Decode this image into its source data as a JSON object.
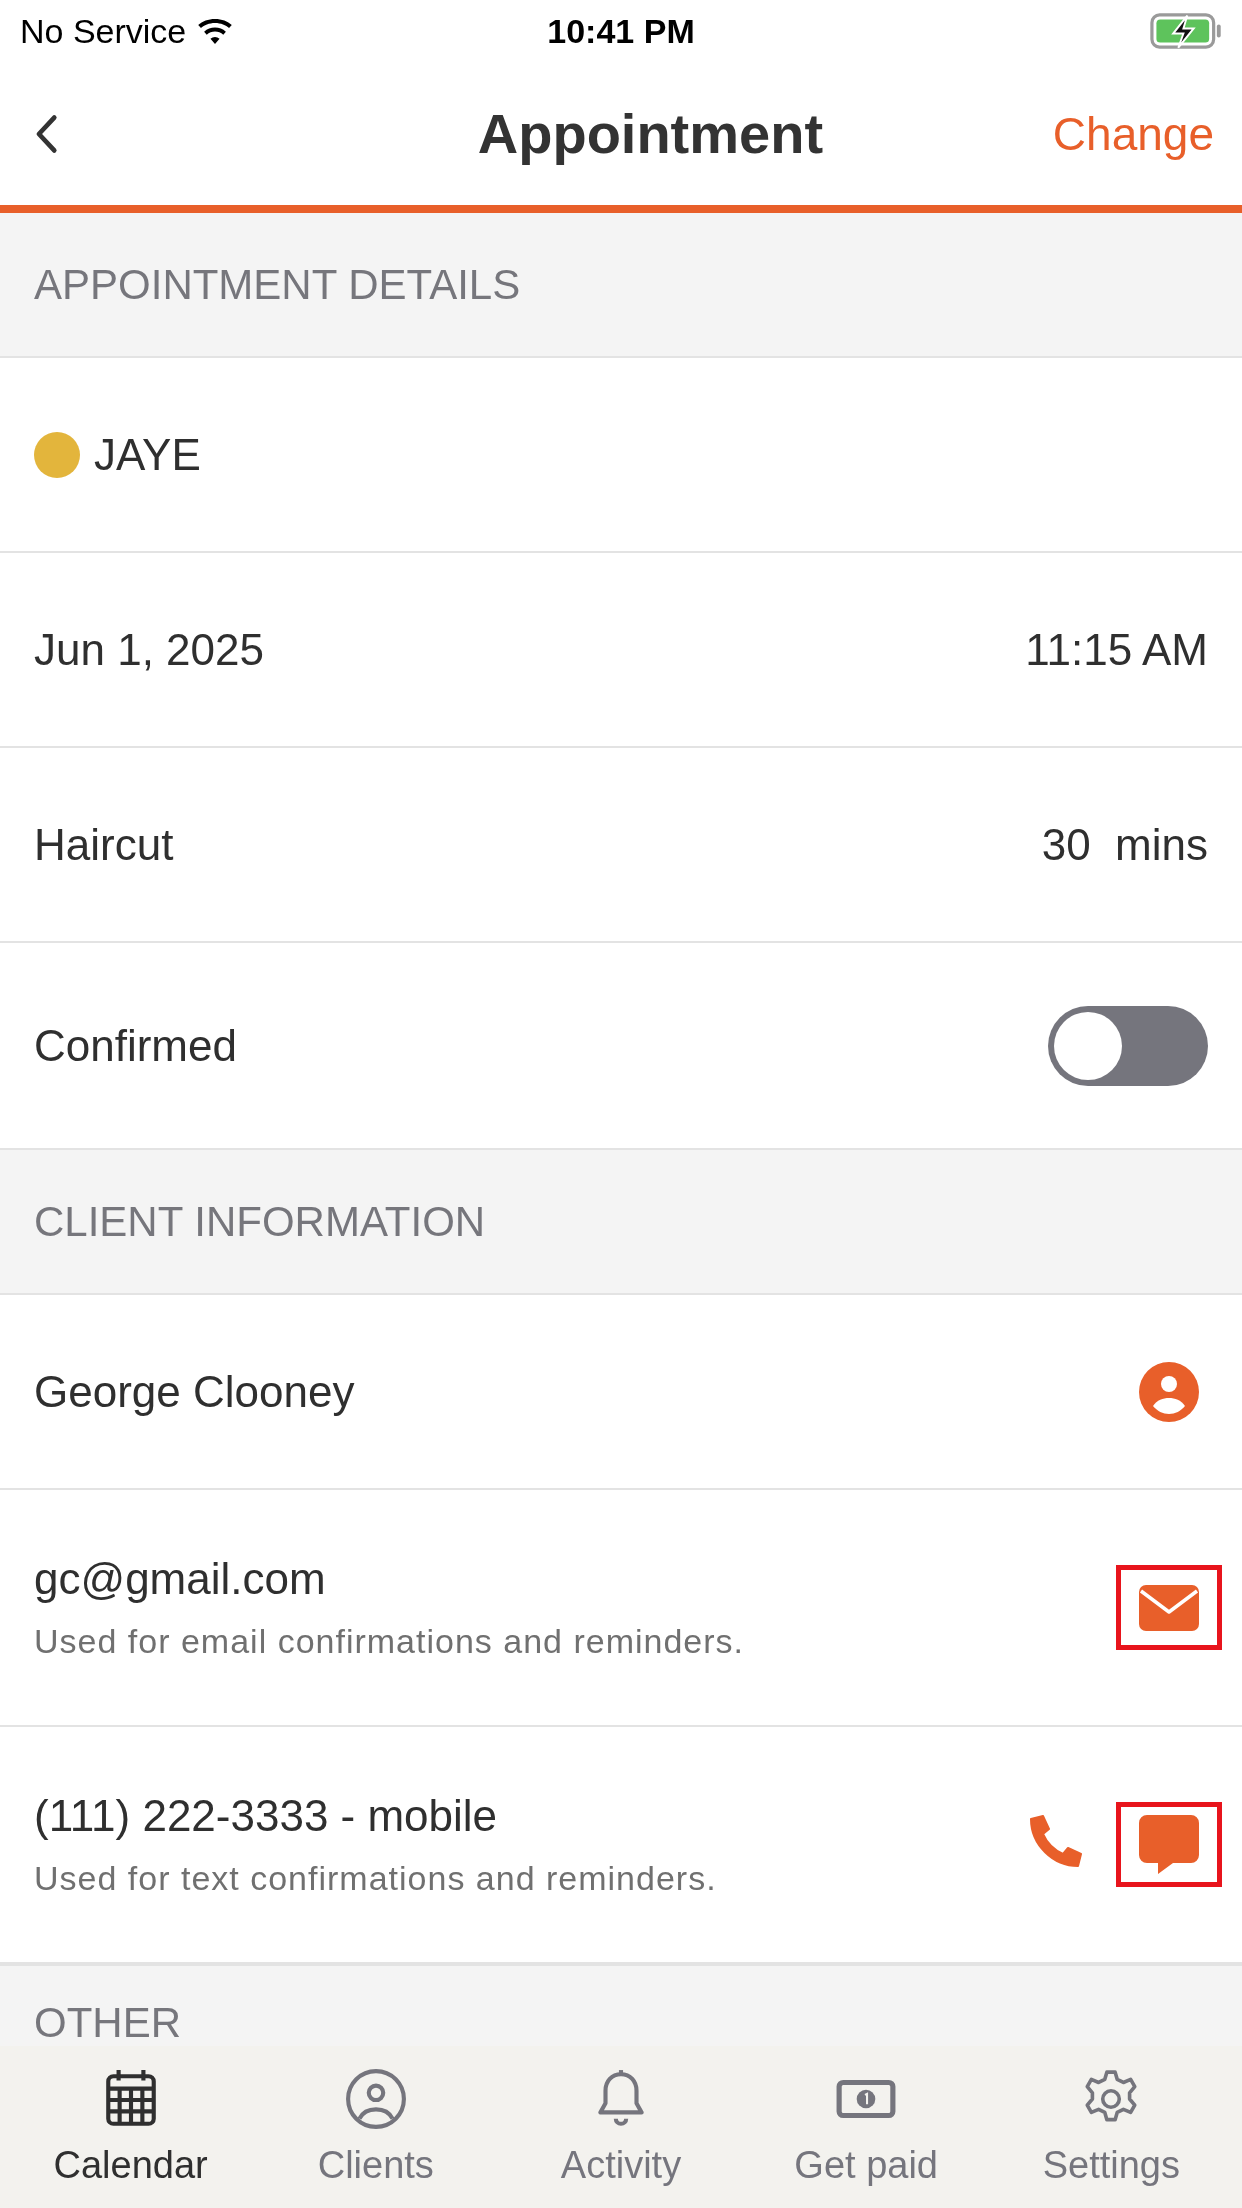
{
  "status_bar": {
    "carrier": "No Service",
    "time": "10:41 PM"
  },
  "nav": {
    "title": "Appointment",
    "action": "Change"
  },
  "sections": [
    {
      "header": "APPOINTMENT DETAILS",
      "rows": [
        {
          "kind": "staff",
          "label": "JAYE",
          "color": "#e3b53c"
        },
        {
          "kind": "pair",
          "label": "Jun 1, 2025",
          "value": "11:15 AM"
        },
        {
          "kind": "pair",
          "label": "Haircut",
          "value": "30  mins"
        },
        {
          "kind": "toggle",
          "label": "Confirmed",
          "on": false
        }
      ]
    },
    {
      "header": "CLIENT INFORMATION",
      "rows": [
        {
          "kind": "contact",
          "label": "George Clooney",
          "actions": [
            {
              "kind": "person",
              "highlighted": false
            }
          ]
        },
        {
          "kind": "contact",
          "label": "gc@gmail.com",
          "note": "Used for email confirmations and reminders.",
          "actions": [
            {
              "kind": "email",
              "highlighted": true
            }
          ]
        },
        {
          "kind": "contact",
          "label": "(111) 222-3333 - mobile",
          "note": "Used for text confirmations and reminders.",
          "actions": [
            {
              "kind": "phone",
              "highlighted": false
            },
            {
              "kind": "message",
              "highlighted": true
            }
          ]
        }
      ]
    },
    {
      "header": "OTHER"
    }
  ],
  "tabs": [
    {
      "label": "Calendar",
      "kind": "calendar",
      "selected": true
    },
    {
      "label": "Clients",
      "kind": "person",
      "selected": false
    },
    {
      "label": "Activity",
      "kind": "bell",
      "selected": false
    },
    {
      "label": "Get paid",
      "kind": "money",
      "selected": false
    },
    {
      "label": "Settings",
      "kind": "gear",
      "selected": false
    }
  ]
}
